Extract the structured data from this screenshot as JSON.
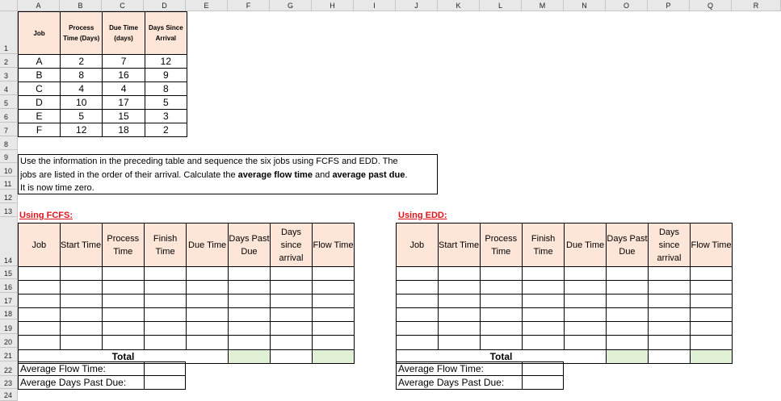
{
  "columns": [
    "A",
    "B",
    "C",
    "D",
    "E",
    "F",
    "G",
    "H",
    "I",
    "J",
    "K",
    "L",
    "M",
    "N",
    "O",
    "P",
    "Q",
    "R"
  ],
  "rows": [
    "1",
    "2",
    "3",
    "4",
    "5",
    "6",
    "7",
    "8",
    "9",
    "10",
    "11",
    "12",
    "13",
    "14",
    "15",
    "16",
    "17",
    "18",
    "19",
    "20",
    "21",
    "22",
    "23",
    "24"
  ],
  "data_table": {
    "headers": [
      "Job",
      "Process Time (Days)",
      "Due Time (days)",
      "Days Since Arrival"
    ],
    "rows": [
      [
        "A",
        "2",
        "7",
        "12"
      ],
      [
        "B",
        "8",
        "16",
        "9"
      ],
      [
        "C",
        "4",
        "4",
        "8"
      ],
      [
        "D",
        "10",
        "17",
        "5"
      ],
      [
        "E",
        "5",
        "15",
        "3"
      ],
      [
        "F",
        "12",
        "18",
        "2"
      ]
    ]
  },
  "instructions": {
    "line1": "Use the information in the preceding table and sequence the six jobs using FCFS and EDD. The",
    "line2_pre": "jobs are listed in the order of their arrival. Calculate the ",
    "line2_b1": "average flow time",
    "line2_mid": " and ",
    "line2_b2": "average past due",
    "line2_end": ".",
    "line3": "It is now time zero."
  },
  "fcfs": {
    "label": "Using FCFS:"
  },
  "edd": {
    "label": "Using EDD:"
  },
  "schedule_headers": [
    "Job",
    "Start Time",
    "Process Time",
    "Finish Time",
    "Due Time",
    "Days Past Due",
    "Days since arrival",
    "Flow Time"
  ],
  "total_label": "Total",
  "avg_flow_label": "Average Flow Time:",
  "avg_past_label": "Average Days Past Due:"
}
